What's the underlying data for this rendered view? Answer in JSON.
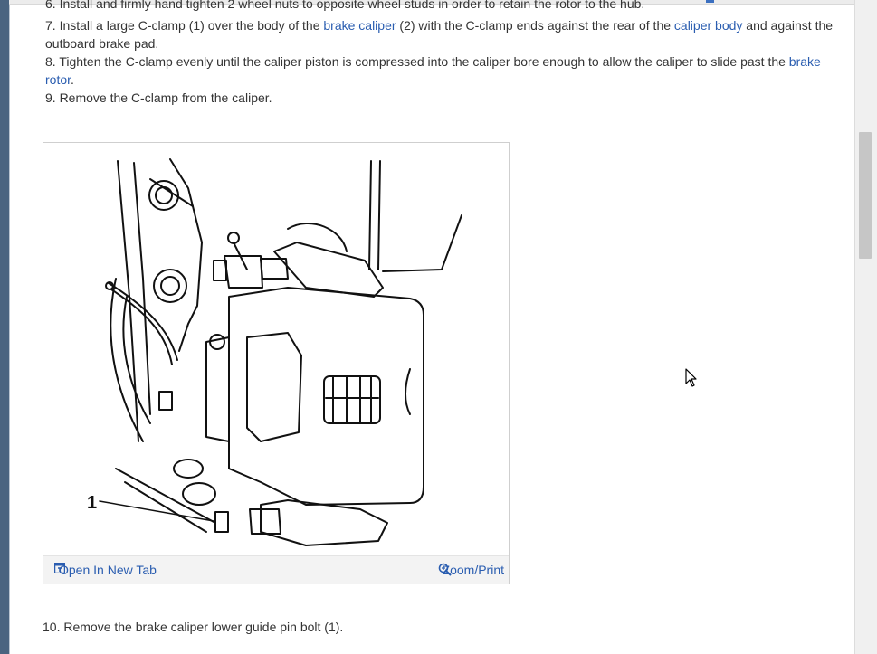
{
  "steps": {
    "step6_text": "6. Install and firmly hand tighten 2 wheel nuts to opposite wheel studs in order to retain the rotor to the hub.",
    "step7": {
      "prefix": "7. Install a large C-clamp (1) over the body of the ",
      "link1": "brake caliper",
      "middle": " (2) with the C-clamp ends against the rear of the ",
      "link2": "caliper body",
      "suffix": " and against the outboard brake pad."
    },
    "step8": {
      "prefix": "8. Tighten the C-clamp evenly until the caliper piston is compressed into the caliper bore enough to allow the caliper to slide past the ",
      "link": "brake rotor",
      "suffix": "."
    },
    "step9_text": "9. Remove the C-clamp from the caliper.",
    "step10_text": "10. Remove the brake caliper lower guide pin bolt (1)."
  },
  "figure": {
    "callout_label": "1",
    "open_new_tab_label": "Open In New Tab",
    "zoom_print_label": "Zoom/Print",
    "open_icon": "open-in-new-tab-icon",
    "zoom_icon": "magnifier-plus-icon"
  },
  "colors": {
    "link": "#2a5db0",
    "text": "#333333",
    "toolbar_bg": "#f3f3f3"
  }
}
